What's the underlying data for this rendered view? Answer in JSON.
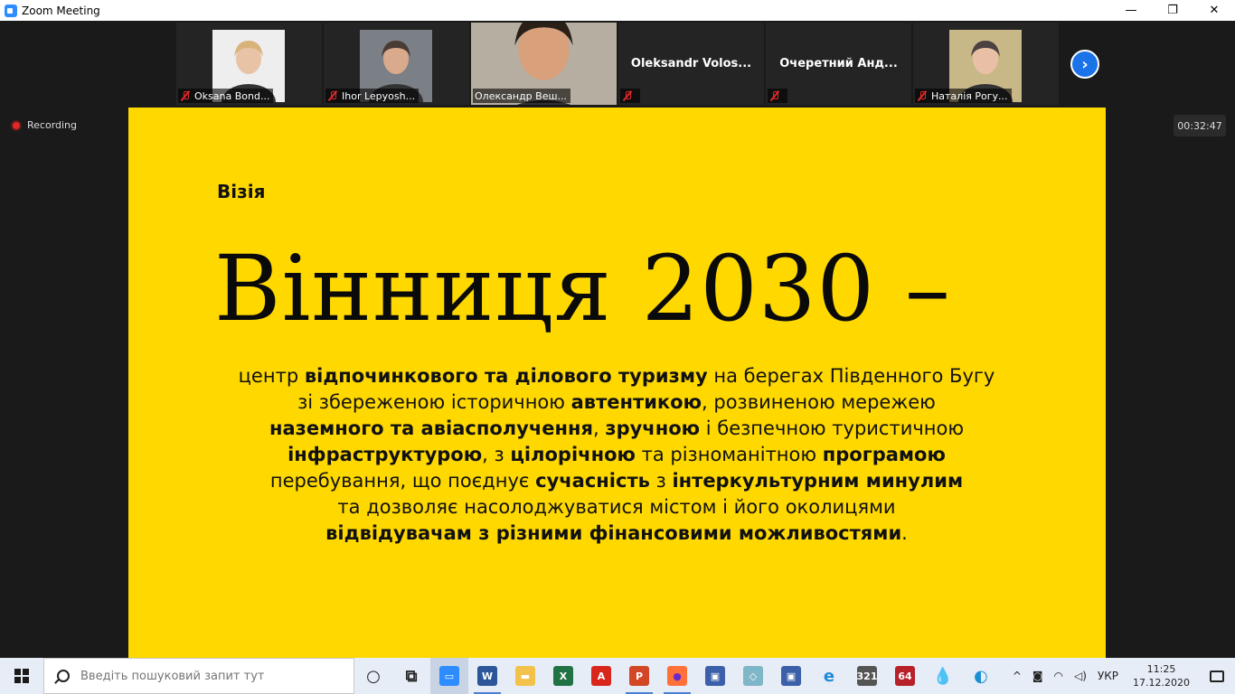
{
  "window": {
    "title": "Zoom Meeting",
    "minimize": "—",
    "maximize": "❐",
    "close": "✕"
  },
  "participants": [
    {
      "name": "Oksana Bond...",
      "video": true,
      "muted": true,
      "skin": "#e8c3a6",
      "hair": "#d9b27a",
      "bg": "#eeeeee"
    },
    {
      "name": "Ihor Lepyosh...",
      "video": true,
      "muted": true,
      "skin": "#d9aa8c",
      "hair": "#4a3b33",
      "bg": "#7b7f86"
    },
    {
      "name": "Олександр Веш...",
      "video": true,
      "muted": false,
      "active": true,
      "skin": "#d9a07c",
      "hair": "#2a2018",
      "bg": "#b6aea0"
    },
    {
      "name": "Oleksandr  Volos...",
      "video": false,
      "muted": true
    },
    {
      "name": "Очеретний  Анд...",
      "video": false,
      "muted": true
    },
    {
      "name": "Наталія Рогу...",
      "video": true,
      "muted": true,
      "skin": "#e9c0a6",
      "hair": "#4a4140",
      "bg": "#c8b888"
    }
  ],
  "next_arrow": "›",
  "recording_label": "Recording",
  "timer": "00:32:47",
  "slide": {
    "heading": "Візія",
    "title": "Вінниця 2030 –",
    "lines": [
      [
        {
          "t": "центр ",
          "b": false
        },
        {
          "t": "відпочинкового та ділового туризму",
          "b": true
        },
        {
          "t": " на берегах Південного Бугу",
          "b": false
        }
      ],
      [
        {
          "t": "зі збереженою історичною ",
          "b": false
        },
        {
          "t": "автентикою",
          "b": true
        },
        {
          "t": ", розвиненою мережею",
          "b": false
        }
      ],
      [
        {
          "t": "наземного та авіасполучення",
          "b": true
        },
        {
          "t": ", ",
          "b": false
        },
        {
          "t": "зручною",
          "b": true
        },
        {
          "t": " і безпечною туристичною",
          "b": false
        }
      ],
      [
        {
          "t": "інфраструктурою",
          "b": true
        },
        {
          "t": ", з ",
          "b": false
        },
        {
          "t": "цілорічною",
          "b": true
        },
        {
          "t": " та різноманітною ",
          "b": false
        },
        {
          "t": "програмою",
          "b": true
        }
      ],
      [
        {
          "t": "перебування, що поєднує ",
          "b": false
        },
        {
          "t": "сучасність",
          "b": true
        },
        {
          "t": " з ",
          "b": false
        },
        {
          "t": "інтеркультурним минулим",
          "b": true
        }
      ],
      [
        {
          "t": "та дозволяє насолоджуватися містом і його околицями",
          "b": false
        }
      ],
      [
        {
          "t": "відвідувачам з різними фінансовими можливостями",
          "b": true
        },
        {
          "t": ".",
          "b": false
        }
      ]
    ]
  },
  "taskbar": {
    "search_placeholder": "Введіть пошуковий запит тут",
    "apps": [
      {
        "name": "cortana-icon",
        "glyph": "○",
        "color": "transparent",
        "fg": "#222"
      },
      {
        "name": "task-view-icon",
        "glyph": "⧉",
        "color": "transparent",
        "fg": "#222"
      },
      {
        "name": "zoom-app-icon",
        "glyph": "▭",
        "color": "#2d8cff",
        "fg": "#fff",
        "active": true
      },
      {
        "name": "word-icon",
        "glyph": "W",
        "color": "#2b579a",
        "fg": "#fff",
        "running": true
      },
      {
        "name": "file-explorer-icon",
        "glyph": "▬",
        "color": "#f3c24a",
        "fg": "#fff"
      },
      {
        "name": "excel-icon",
        "glyph": "X",
        "color": "#217346",
        "fg": "#fff"
      },
      {
        "name": "acrobat-icon",
        "glyph": "A",
        "color": "#d9261c",
        "fg": "#fff"
      },
      {
        "name": "powerpoint-icon",
        "glyph": "P",
        "color": "#d24726",
        "fg": "#fff",
        "running": true
      },
      {
        "name": "firefox-icon",
        "glyph": "●",
        "color": "#ff7139",
        "fg": "#6a2ac9",
        "running": true
      },
      {
        "name": "save-disk-icon",
        "glyph": "▣",
        "color": "#3b5fa8",
        "fg": "#fff"
      },
      {
        "name": "notes-icon",
        "glyph": "◇",
        "color": "#7fb6c8",
        "fg": "#fff"
      },
      {
        "name": "save-disk-2-icon",
        "glyph": "▣",
        "color": "#3b5fa8",
        "fg": "#fff"
      },
      {
        "name": "internet-explorer-icon",
        "glyph": "e",
        "color": "transparent",
        "fg": "#1e8ad6"
      },
      {
        "name": "media-player-icon",
        "glyph": "321",
        "color": "#555",
        "fg": "#fff"
      },
      {
        "name": "game-icon",
        "glyph": "64",
        "color": "#b8202a",
        "fg": "#fff"
      },
      {
        "name": "paint-drop-icon",
        "glyph": "💧",
        "color": "transparent",
        "fg": "#c040c0"
      },
      {
        "name": "edge-icon",
        "glyph": "◐",
        "color": "transparent",
        "fg": "#1b8fd4"
      }
    ],
    "tray_chevron": "^",
    "language": "УКР",
    "time": "11:25",
    "date": "17.12.2020"
  }
}
